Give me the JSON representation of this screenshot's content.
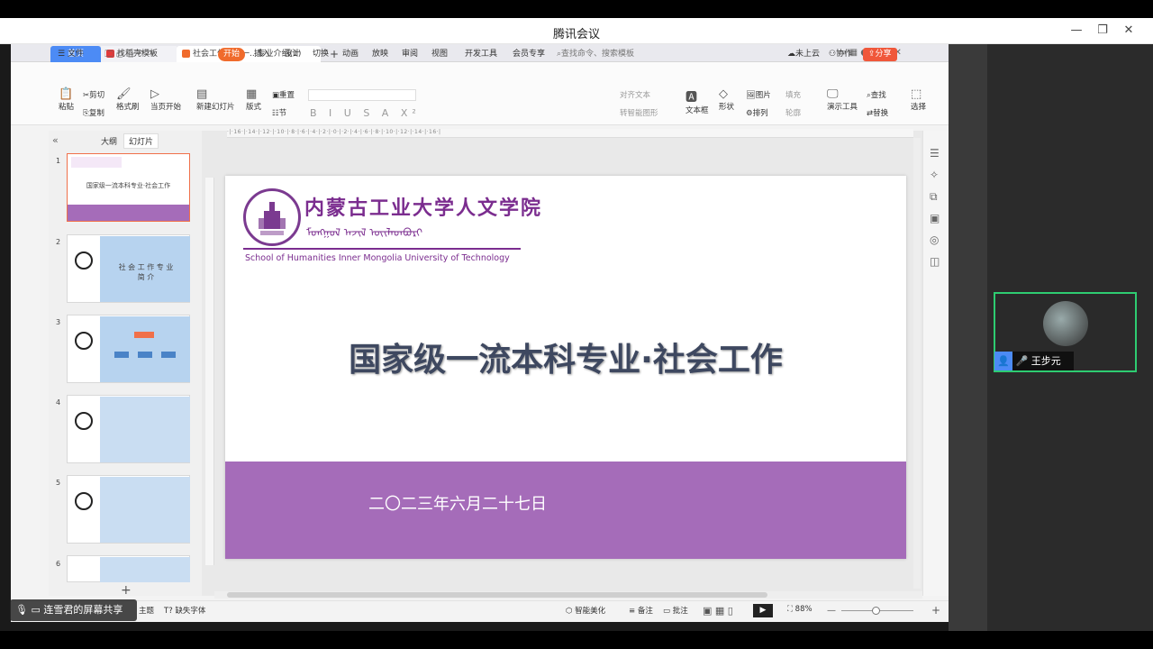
{
  "meeting": {
    "title": "腾讯会议",
    "min": "—",
    "restore": "❐",
    "close": "✕"
  },
  "tabs": {
    "home": "首页",
    "template": "找稻壳模板",
    "doc": "社会工作国家一...专业介绍(1)",
    "add": "+"
  },
  "menu": {
    "file": "文件",
    "start": "开始",
    "insert": "插入",
    "design": "设计",
    "switch": "切换",
    "animation": "动画",
    "slideshow": "放映",
    "review": "审阅",
    "view": "视图",
    "dev": "开发工具",
    "member": "会员专享",
    "search": "查找命令、搜索模板",
    "cloud": "未上云",
    "collab": "协作",
    "share": "分享"
  },
  "ribbon": {
    "paste": "粘贴",
    "cut": "剪切",
    "copy": "复制",
    "format": "格式刷",
    "play": "当页开始",
    "new_slide": "新建幻灯片",
    "layout": "版式",
    "section": "节",
    "reset": "重置",
    "align_text": "对齐文本",
    "smart": "转智能图形",
    "textbox": "文本框",
    "shape": "形状",
    "arrange": "排列",
    "picture": "图片",
    "fill": "填充",
    "outline": "轮廓",
    "present": "演示工具",
    "find": "查找",
    "replace": "替换",
    "select": "选择"
  },
  "pane": {
    "outline": "大纲",
    "slides": "幻灯片",
    "collapse": "«",
    "add": "+"
  },
  "thumbs": [
    "1",
    "2",
    "3",
    "4",
    "5",
    "6"
  ],
  "thumb_titles": {
    "t1": "国家级一流本科专业·社会工作",
    "t2": "社 会 工 作 专 业\n简 介"
  },
  "slide": {
    "school_cn": "内蒙古工业大学人文学院",
    "school_mn": "ᠮᠣᠩᠭᠣᠯ ᠠᠵᠢᠯ ᠦᠢᠯᠡᠳᠪᠦᠷᠢ",
    "school_en": "School of Humanities Inner Mongolia University of Technology",
    "title": "国家级一流本科专业·社会工作",
    "date": "二〇二三年六月二十七日"
  },
  "status": {
    "theme": "主题",
    "missing_font": "缺失字体",
    "beautify": "智能美化",
    "notes": "备注",
    "comment": "批注",
    "zoom": "88%"
  },
  "share_label": "连雪君的屏幕共享",
  "participant": {
    "name": "王步元"
  },
  "colors": {
    "accent": "#4c8bf5",
    "brand_orange": "#f06b2c",
    "slide_band": "#a56cb9",
    "school_purple": "#7b2d8f",
    "active_border": "#2ecc71"
  }
}
